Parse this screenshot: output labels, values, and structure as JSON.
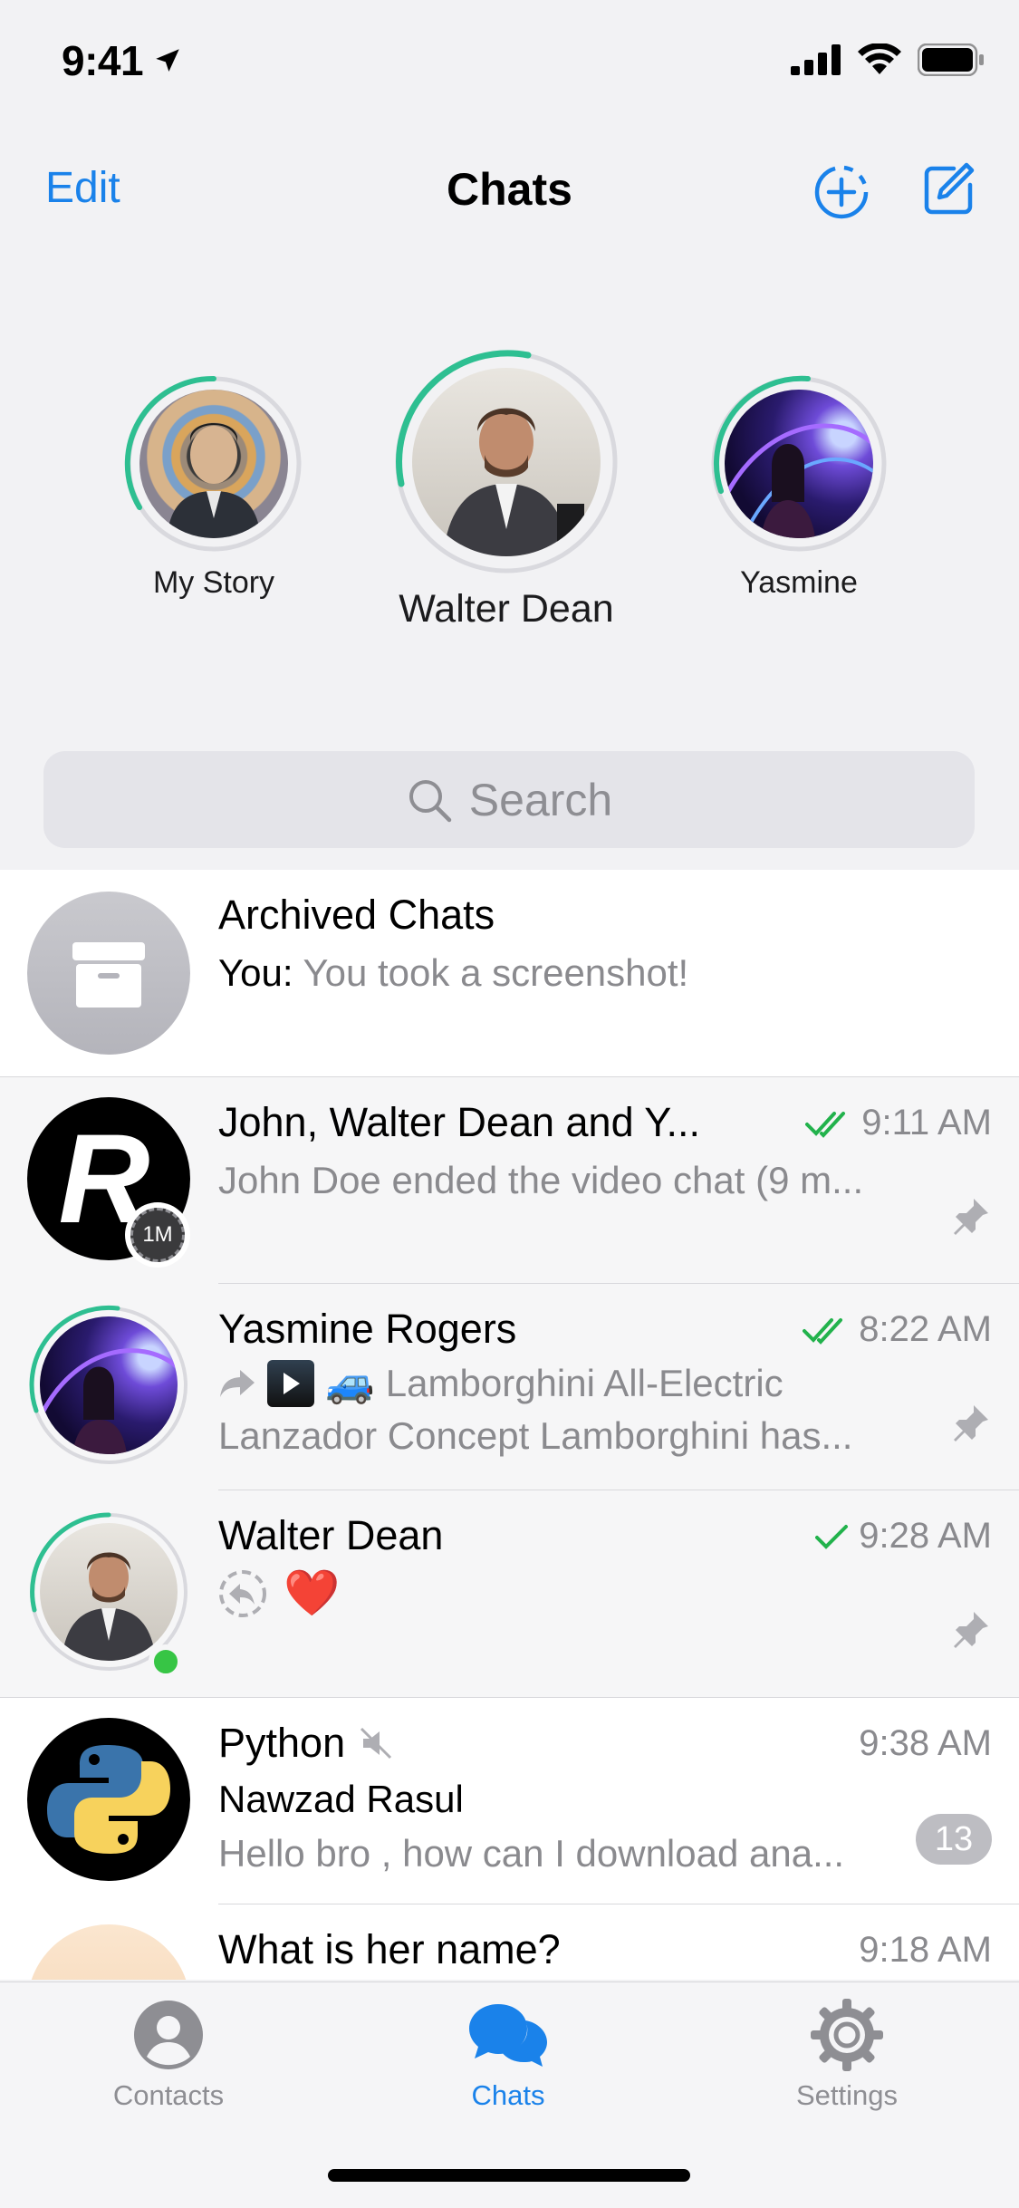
{
  "status_bar": {
    "time": "9:41"
  },
  "nav": {
    "edit": "Edit",
    "title": "Chats"
  },
  "stories": [
    {
      "label": "My Story"
    },
    {
      "label": "Walter Dean"
    },
    {
      "label": "Yasmine"
    }
  ],
  "search": {
    "placeholder": "Search"
  },
  "chats": [
    {
      "name": "Archived Chats",
      "prefix": "You:",
      "message": "You took a screenshot!"
    },
    {
      "name": "John, Walter Dean and Y...",
      "time": "9:11 AM",
      "message": "John Doe ended the video chat (9 m...",
      "avatar_text": "R",
      "timer": "1M"
    },
    {
      "name": "Yasmine Rogers",
      "time": "8:22 AM",
      "message1": "Lamborghini All-Electric",
      "message2": "Lanzador Concept Lamborghini has..."
    },
    {
      "name": "Walter Dean",
      "time": "9:28 AM",
      "message": "❤️"
    },
    {
      "name": "Python",
      "time": "9:38 AM",
      "sender": "Nawzad Rasul",
      "message": "Hello bro , how can I download ana...",
      "unread": "13"
    },
    {
      "name": "What is her name?",
      "time": "9:18 AM"
    }
  ],
  "tabs": [
    {
      "label": "Contacts"
    },
    {
      "label": "Chats"
    },
    {
      "label": "Settings"
    }
  ],
  "colors": {
    "accent": "#1a82ea",
    "story_ring": "#2ebf91",
    "online": "#37c545",
    "check": "#22b24c"
  }
}
